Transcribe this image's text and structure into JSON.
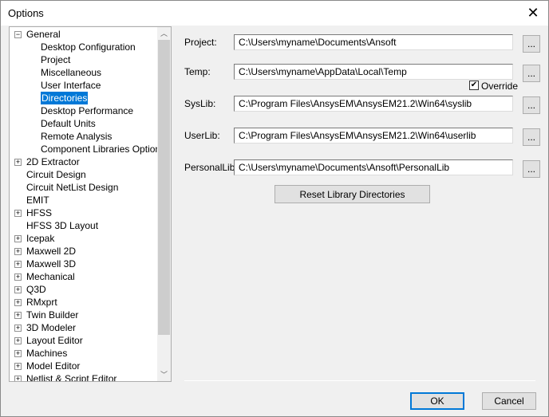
{
  "window": {
    "title": "Options",
    "close_icon": "close-icon"
  },
  "tree": {
    "general": {
      "label": "General",
      "expanded": true,
      "children": [
        "Desktop Configuration",
        "Project",
        "Miscellaneous",
        "User Interface",
        "Directories",
        "Desktop Performance",
        "Default Units",
        "Remote Analysis",
        "Component Libraries Options"
      ],
      "selected": "Directories"
    },
    "items": [
      {
        "label": "2D Extractor",
        "expandable": true
      },
      {
        "label": "Circuit Design",
        "expandable": false
      },
      {
        "label": "Circuit NetList Design",
        "expandable": false
      },
      {
        "label": "EMIT",
        "expandable": false
      },
      {
        "label": "HFSS",
        "expandable": true
      },
      {
        "label": "HFSS 3D Layout",
        "expandable": false
      },
      {
        "label": "Icepak",
        "expandable": true
      },
      {
        "label": "Maxwell 2D",
        "expandable": true
      },
      {
        "label": "Maxwell 3D",
        "expandable": true
      },
      {
        "label": "Mechanical",
        "expandable": true
      },
      {
        "label": "Q3D",
        "expandable": true
      },
      {
        "label": "RMxprt",
        "expandable": true
      },
      {
        "label": "Twin Builder",
        "expandable": true
      },
      {
        "label": "3D Modeler",
        "expandable": true
      },
      {
        "label": "Layout Editor",
        "expandable": true
      },
      {
        "label": "Machines",
        "expandable": true
      },
      {
        "label": "Model Editor",
        "expandable": true
      },
      {
        "label": "Netlist & Script Editor",
        "expandable": true
      }
    ]
  },
  "directories": {
    "fields": [
      {
        "label": "Project:",
        "value": "C:\\Users\\myname\\Documents\\Ansoft"
      },
      {
        "label": "Temp:",
        "value": "C:\\Users\\myname\\AppData\\Local\\Temp"
      },
      {
        "label": "SysLib:",
        "value": "C:\\Program Files\\AnsysEM\\AnsysEM21.2\\Win64\\syslib"
      },
      {
        "label": "UserLib:",
        "value": "C:\\Program Files\\AnsysEM\\AnsysEM21.2\\Win64\\userlib"
      },
      {
        "label": "PersonalLib:",
        "value": "C:\\Users\\myname\\Documents\\Ansoft\\PersonalLib"
      }
    ],
    "browse_label": "...",
    "override": {
      "label": "Override",
      "checked": true
    },
    "reset_label": "Reset Library Directories"
  },
  "footer": {
    "ok": "OK",
    "cancel": "Cancel"
  },
  "colors": {
    "selection": "#0078d7"
  }
}
